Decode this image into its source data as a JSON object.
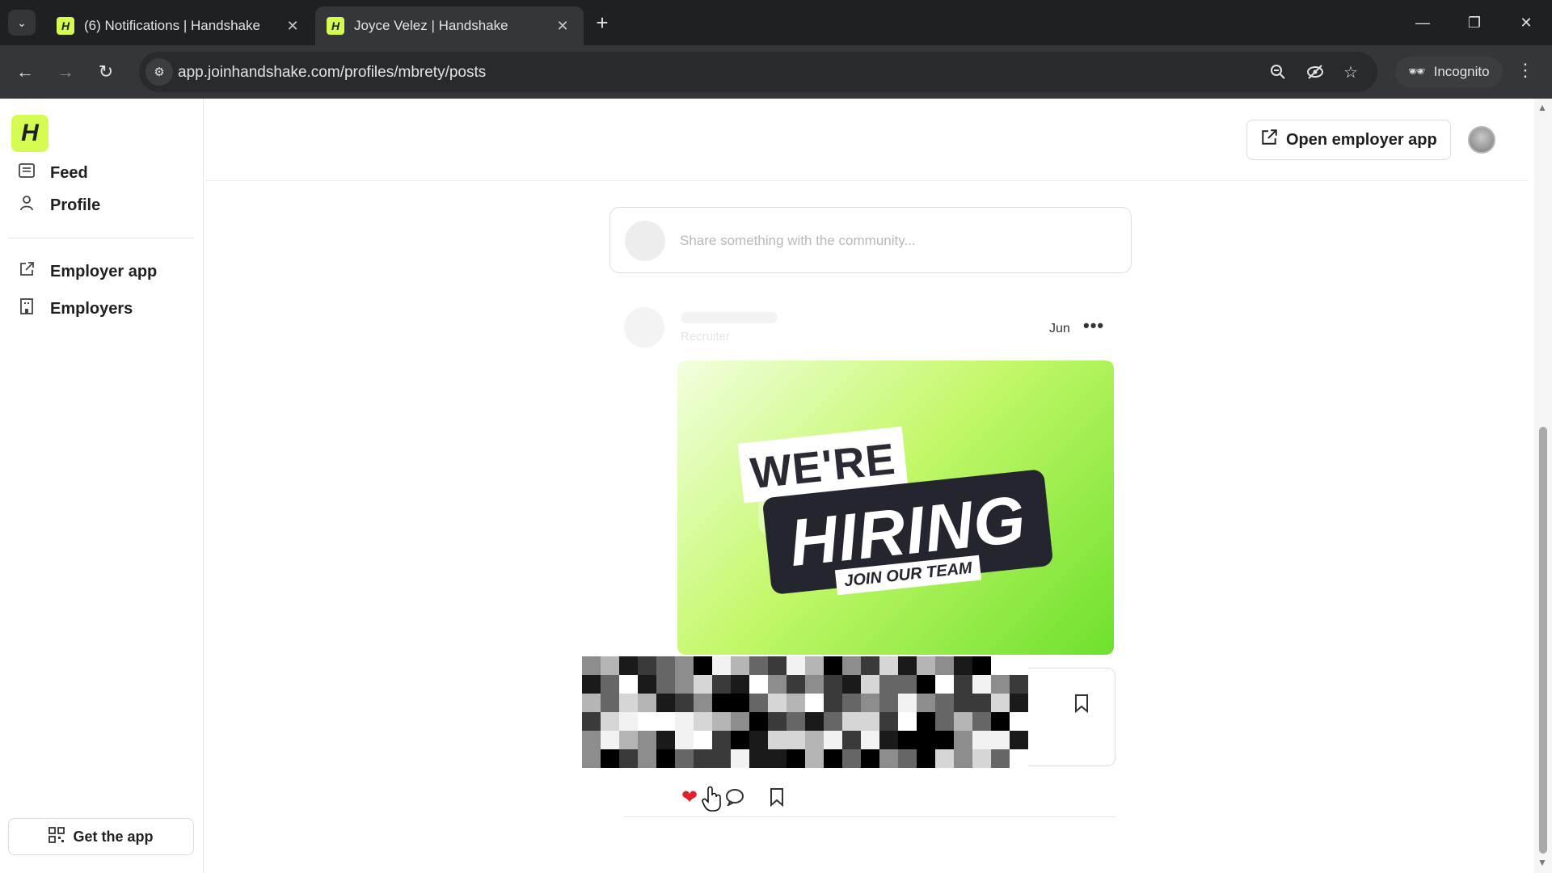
{
  "browser": {
    "tabs": [
      {
        "title": "(6) Notifications | Handshake",
        "favicon": "handshake-icon",
        "active": false
      },
      {
        "title": "Joyce Velez | Handshake",
        "favicon": "handshake-icon",
        "active": true
      }
    ],
    "new_tab": "+",
    "url": "app.joinhandshake.com/profiles/mbrety/posts",
    "incognito_label": "Incognito",
    "favicon_letter": "H"
  },
  "sidebar": {
    "logo": "H",
    "primary": [
      {
        "label": "Feed",
        "icon": "feed-icon"
      },
      {
        "label": "Profile",
        "icon": "person-icon"
      }
    ],
    "secondary": [
      {
        "label": "Employer app",
        "icon": "external-link-icon"
      },
      {
        "label": "Employers",
        "icon": "building-icon"
      }
    ],
    "get_app": "Get the app"
  },
  "header": {
    "open_employer_app": "Open employer app"
  },
  "composer": {
    "placeholder": "Share something with the community..."
  },
  "post": {
    "subtitle": "Recruiter",
    "date": "Jun",
    "more": "•••",
    "image": {
      "line1": "WE'RE",
      "line2": "HIRING",
      "line3": "JOIN OUR TEAM"
    },
    "liked": true
  },
  "colors": {
    "brand": "#d3fb52",
    "like": "#e0202c",
    "chrome_bg": "#1f2023"
  }
}
